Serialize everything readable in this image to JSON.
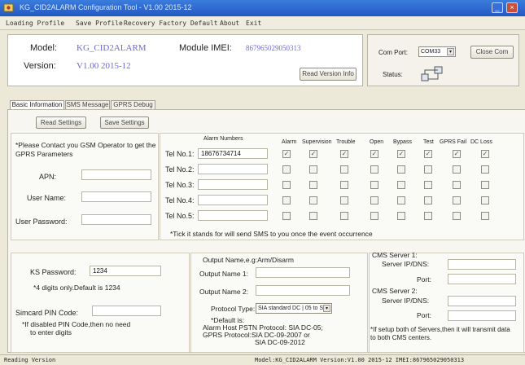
{
  "window": {
    "title": "KG_CID2ALARM Configuration Tool - V1.00 2015-12",
    "minimize_glyph": "_",
    "close_glyph": "×"
  },
  "menu": [
    "Loading Profile",
    "Save Profile",
    "Recovery Factory Default",
    "About",
    "Exit"
  ],
  "header": {
    "model_label": "Model:",
    "model_value": "KG_CID2ALARM",
    "version_label": "Version:",
    "version_value": "V1.00 2015-12",
    "imei_label": "Module IMEI:",
    "imei_value": "867965029050313",
    "read_version_btn": "Read Version Info",
    "com_port_label": "Com Port:",
    "com_port_value": "COM33",
    "close_com_btn": "Close Com",
    "status_label": "Status:"
  },
  "tabs": [
    "Basic Information",
    "SMS Message",
    "GPRS Debug"
  ],
  "toolbar": {
    "read_settings": "Read Settings",
    "save_settings": "Save Settings"
  },
  "gsm": {
    "note": "*Please Contact you GSM Operator to get the GPRS Parameters",
    "apn_label": "APN:",
    "user_label": "User Name:",
    "password_label": "User Password:",
    "apn_value": "",
    "user_value": "",
    "password_value": ""
  },
  "alarm_table": {
    "header_numbers": "Alarm Numbers",
    "columns": [
      "Alarm",
      "Supervision",
      "Trouble",
      "Open",
      "Bypass",
      "Test",
      "GPRS Fail",
      "DC Loss"
    ],
    "rows": [
      {
        "label": "Tel No.1:",
        "number": "18676734714",
        "checks": [
          true,
          true,
          true,
          true,
          true,
          true,
          true,
          true
        ]
      },
      {
        "label": "Tel No.2:",
        "number": "",
        "checks": [
          false,
          false,
          false,
          false,
          false,
          false,
          false,
          false
        ]
      },
      {
        "label": "Tel No.3:",
        "number": "",
        "checks": [
          false,
          false,
          false,
          false,
          false,
          false,
          false,
          false
        ]
      },
      {
        "label": "Tel No.4:",
        "number": "",
        "checks": [
          false,
          false,
          false,
          false,
          false,
          false,
          false,
          false
        ]
      },
      {
        "label": "Tel No.5:",
        "number": "",
        "checks": [
          false,
          false,
          false,
          false,
          false,
          false,
          false,
          false
        ]
      }
    ],
    "note": "*Tick it stands for will send SMS to you once the event occurrence"
  },
  "security": {
    "ks_label": "KS Password:",
    "ks_value": "1234",
    "ks_note": "*4 digits only.Default is 1234",
    "pin_label": "Simcard PIN Code:",
    "pin_value": "",
    "pin_note_1": "*If disabled PIN Code,then no need",
    "pin_note_2": "to enter digits"
  },
  "output": {
    "heading": "Output Name,e.g:Arm/Disarm",
    "name1_label": "Output Name 1:",
    "name2_label": "Output Name 2:",
    "name1_value": "",
    "name2_value": "",
    "protocol_label": "Protocol Type:",
    "protocol_value": "SIA standard DC | 05 to SI",
    "default_1": "*Default is:",
    "default_2": "Alarm Host PSTN Protocol: SIA DC-05;",
    "default_3": "GPRS Protocol:SIA DC-09-2007 or",
    "default_4": "SIA DC-09-2012"
  },
  "cms": {
    "server1_heading": "CMS Server 1:",
    "server1_ip_label": "Server IP/DNS:",
    "server1_port_label": "Port:",
    "server2_heading": "CMS Server 2:",
    "server2_ip_label": "Server IP/DNS:",
    "server2_port_label": "Port:",
    "note_1": "*If setup both of Servers,then it will transmit data",
    "note_2": "to both CMS centers."
  },
  "statusbar": {
    "left": "Reading Version",
    "right": "Model:KG_CID2ALARM Version:V1.00 2015-12 IMEI:867965029050313"
  },
  "colors": {
    "accent_text": "#6a6ad6",
    "titlebar": "#2358c3",
    "window_bg": "#ece9d8"
  }
}
